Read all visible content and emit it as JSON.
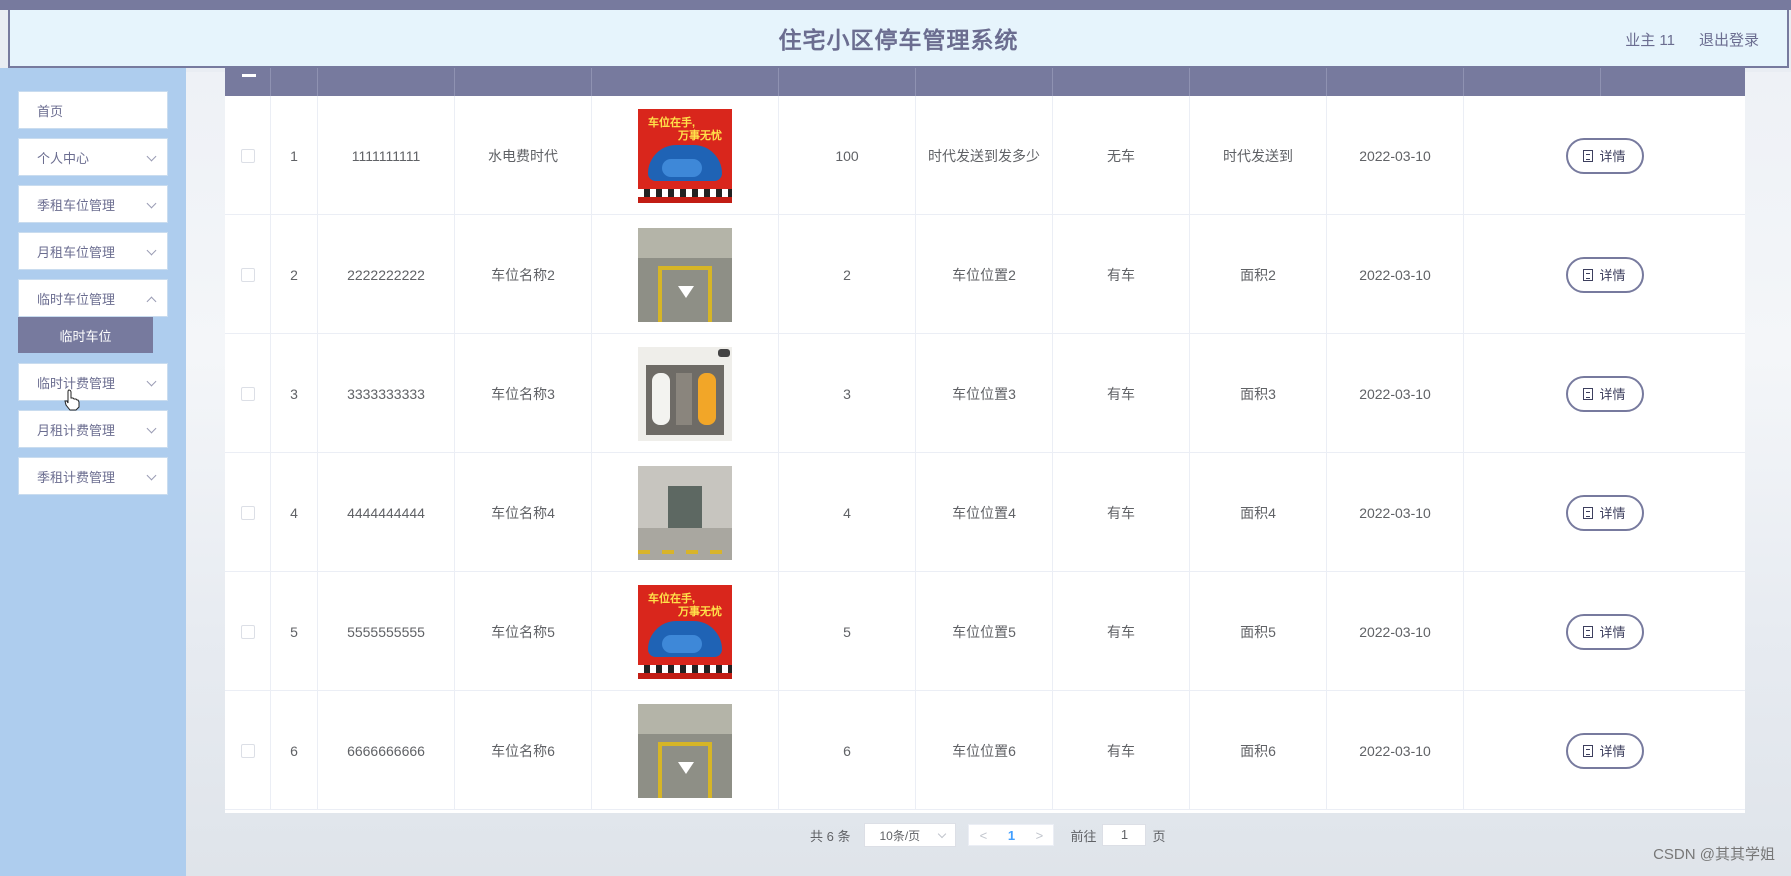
{
  "header": {
    "title": "住宅小区停车管理系统",
    "user": "业主 11",
    "logout": "退出登录"
  },
  "sidebar": {
    "items": [
      {
        "label": "首页",
        "has_children": false
      },
      {
        "label": "个人中心",
        "has_children": true
      },
      {
        "label": "季租车位管理",
        "has_children": true
      },
      {
        "label": "月租车位管理",
        "has_children": true
      },
      {
        "label": "临时车位管理",
        "has_children": true
      },
      {
        "label": "临时计费管理",
        "has_children": true
      },
      {
        "label": "月租计费管理",
        "has_children": true
      },
      {
        "label": "季租计费管理",
        "has_children": true
      }
    ],
    "active_submenu": "临时车位"
  },
  "table": {
    "rows": [
      {
        "index": "1",
        "code": "1111111111",
        "name": "水电费时代",
        "image": "red-poster",
        "number": "100",
        "location": "时代发送到发多少",
        "status": "无车",
        "area": "时代发送到",
        "date": "2022-03-10",
        "action": "详情"
      },
      {
        "index": "2",
        "code": "2222222222",
        "name": "车位名称2",
        "image": "parking-lot",
        "number": "2",
        "location": "车位位置2",
        "status": "有车",
        "area": "面积2",
        "date": "2022-03-10",
        "action": "详情"
      },
      {
        "index": "3",
        "code": "3333333333",
        "name": "车位名称3",
        "image": "top-view-cars",
        "number": "3",
        "location": "车位位置3",
        "status": "有车",
        "area": "面积3",
        "date": "2022-03-10",
        "action": "详情"
      },
      {
        "index": "4",
        "code": "4444444444",
        "name": "车位名称4",
        "image": "garage",
        "number": "4",
        "location": "车位位置4",
        "status": "有车",
        "area": "面积4",
        "date": "2022-03-10",
        "action": "详情"
      },
      {
        "index": "5",
        "code": "5555555555",
        "name": "车位名称5",
        "image": "red-poster",
        "number": "5",
        "location": "车位位置5",
        "status": "有车",
        "area": "面积5",
        "date": "2022-03-10",
        "action": "详情"
      },
      {
        "index": "6",
        "code": "6666666666",
        "name": "车位名称6",
        "image": "parking-lot",
        "number": "6",
        "location": "车位位置6",
        "status": "有车",
        "area": "面积6",
        "date": "2022-03-10",
        "action": "详情"
      }
    ],
    "poster_text_1": "车位在手,",
    "poster_text_2": "万事无忧"
  },
  "pagination": {
    "total": "共 6 条",
    "page_size": "10条/页",
    "prev": "<",
    "current": "1",
    "next": ">",
    "goto_label": "前往",
    "goto_value": "1",
    "goto_suffix": "页"
  },
  "watermark": "CSDN @其其学姐"
}
